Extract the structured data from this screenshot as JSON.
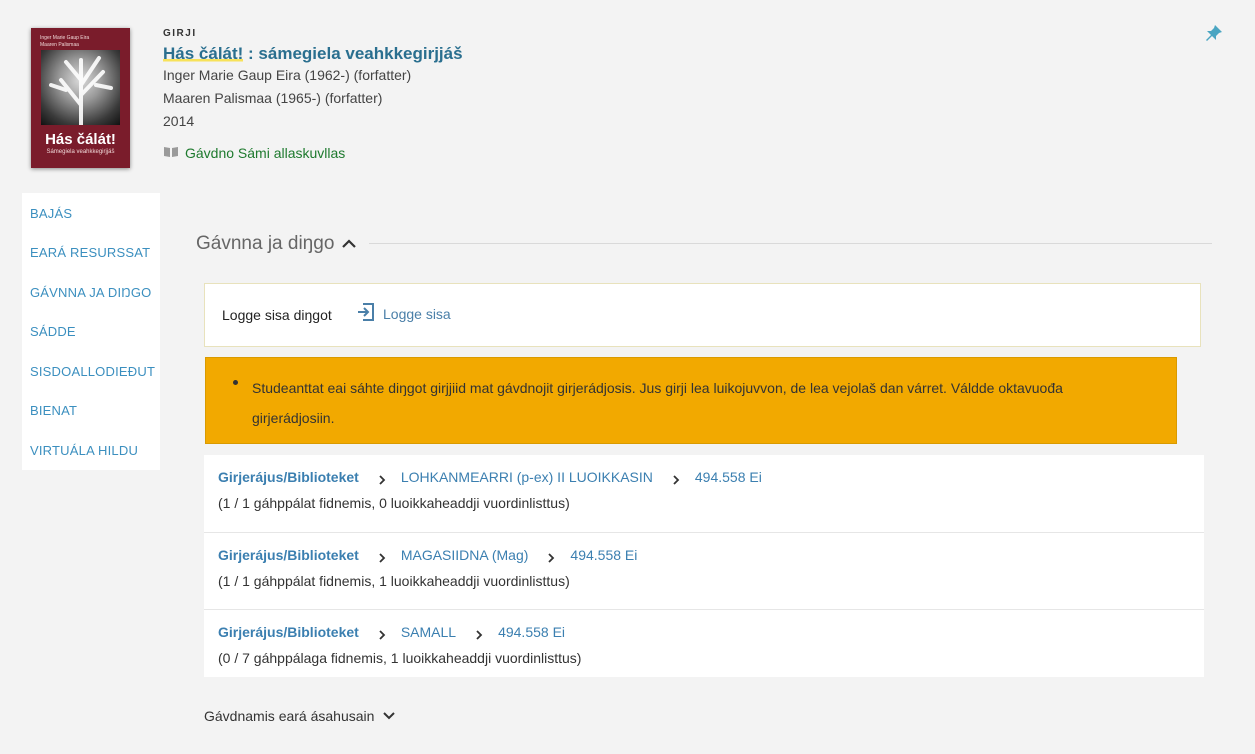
{
  "record": {
    "type": "GIRJI",
    "title_highlight": "Hás čálát!",
    "title_rest": " : sámegiela veahkkegirjjáš",
    "authors": [
      "Inger Marie Gaup Eira (1962-) (forfatter)",
      "Maaren Palismaa (1965-) (forfatter)"
    ],
    "year": "2014",
    "availability": "Gávdno Sámi allaskuvllas",
    "cover": {
      "authors_line1": "Inger Marie Gaup Eira",
      "authors_line2": "Maaren Palismaa",
      "title": "Hás čálát!",
      "subtitle": "Sámegiela veahkkegirjjáš"
    }
  },
  "sidenav": {
    "items": [
      "BAJÁS",
      "EARÁ RESURSSAT",
      "GÁVNNA JA DIŊGO",
      "SÁDDE",
      "SISDOALLODIEĐUT",
      "BIENAT",
      "VIRTUÁLA HILDU"
    ]
  },
  "section": {
    "title": "Gávnna ja diŋgo"
  },
  "login": {
    "label": "Logge sisa diŋgot",
    "button": "Logge sisa"
  },
  "warning": {
    "text": "Studeanttat eai sáhte diŋgot girjjiid mat gávdnojit girjerádjosis. Jus girji lea luikojuvvon, de lea vejolaš dan várret. Váldde oktavuođa girjerádjosiin."
  },
  "holdings": [
    {
      "library": "Girjerájus/Biblioteket",
      "location": "LOHKANMEARRI (p-ex) II LUOIKKASIN",
      "call_number": "494.558 Ei",
      "status": "(1 / 1 gáhppálat fidnemis, 0 luoikkaheaddji vuordinlisttus)"
    },
    {
      "library": "Girjerájus/Biblioteket",
      "location": "MAGASIIDNA (Mag)",
      "call_number": "494.558 Ei",
      "status": "(1 / 1 gáhppálat fidnemis, 1 luoikkaheaddji vuordinlisttus)"
    },
    {
      "library": "Girjerájus/Biblioteket",
      "location": "SAMALL",
      "call_number": "494.558 Ei",
      "status": "(0 / 7 gáhppálaga fidnemis, 1 luoikkaheaddji vuordinlisttus)"
    }
  ],
  "other_institutions": "Gávdnamis eará ásahusain",
  "colors": {
    "accent": "#3b7fb0",
    "warning": "#f2a900",
    "available": "#1e7a2e",
    "pin": "#4aa5c2"
  },
  "icons": [
    "push-pin-icon",
    "book-icon",
    "chevron-up-icon",
    "sign-in-icon",
    "chevron-right-icon",
    "chevron-down-icon"
  ]
}
